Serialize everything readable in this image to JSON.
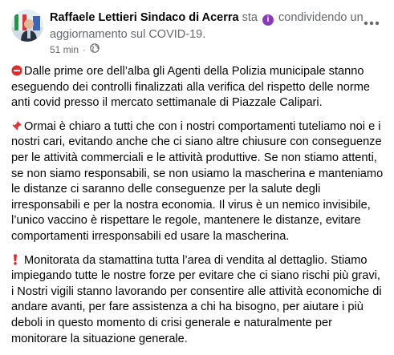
{
  "post": {
    "author": "Raffaele Lettieri Sindaco di Acerra",
    "verb_sta": "sta",
    "verb_condividendo": "condividendo",
    "topic": "un aggiornamento sul COVID-19.",
    "time": "51 min",
    "separator": "·",
    "paragraphs": [
      "Dalle prime ore dell’alba gli Agenti della Polizia municipale stanno eseguendo dei controlli finalizzati alla verifica del rispetto delle norme anti covid presso il mercato settimanale di Piazzale Calipari.",
      "Ormai è chiaro a tutti che con i nostri comportamenti tuteliamo noi e i nostri cari, evitando anche che ci siano altre chiusure con conseguenze per le attività commerciali e le attività produttive. Se non stiamo attenti, se non siamo responsabili, se non usiamo la mascherina e manteniamo le distanze ci saranno delle conseguenze per la salute degli irresponsabili e per la nostra economia. Il virus è un nemico invisibile, l’unico vaccino è rispettare le regole, mantenere le distanze, evitare comportamenti irresponsabili ed usare la mascherina.",
      "Monitorata da stamattina tutta l’area di vendita al dettaglio. Stiamo impiegando tutte le nostre forze per evitare che ci siano rischi più gravi, i Nostri vigili stanno lavorando per consentire alle attività economiche di andare avanti, per fare assistenza a chi ha bisogno, per aiutare i più deboli in questo momento di crisi generale e naturalmente per monitorare la situazione generale."
    ],
    "icons": [
      "no-entry-icon",
      "pushpin-icon",
      "exclamation-icon",
      "globe-icon",
      "more-options-icon",
      "info-icon"
    ],
    "colors": {
      "text": "#050505",
      "secondary": "#65676b",
      "badge": "#8a3ab9",
      "no_entry": "#e02b2b",
      "pin": "#d63a3a",
      "exclaim": "#e0262b"
    }
  }
}
